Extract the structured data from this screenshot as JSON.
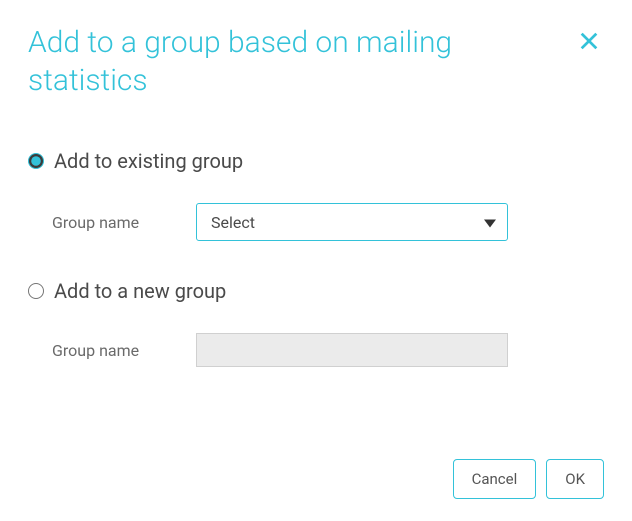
{
  "dialog": {
    "title": "Add to a group based on mailing statistics"
  },
  "options": {
    "existing": {
      "label": "Add to existing group",
      "field_label": "Group name",
      "select_value": "Select",
      "checked": true
    },
    "new": {
      "label": "Add to a new group",
      "field_label": "Group name",
      "input_value": "",
      "checked": false
    }
  },
  "footer": {
    "cancel_label": "Cancel",
    "ok_label": "OK"
  }
}
